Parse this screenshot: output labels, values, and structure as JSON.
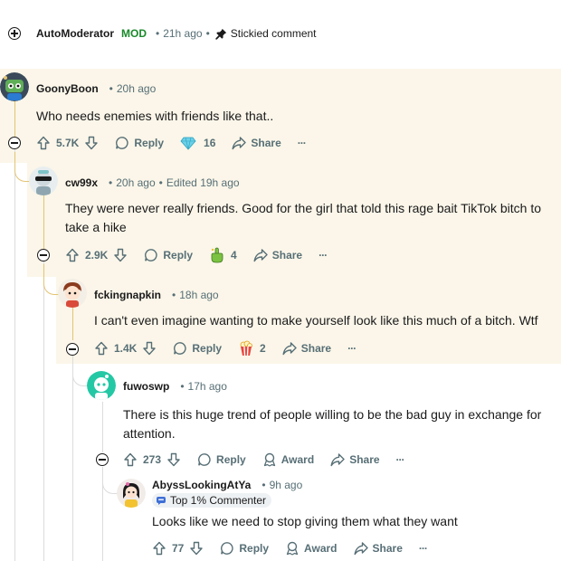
{
  "automod": {
    "user": "AutoModerator",
    "flair": "MOD",
    "time": "21h ago",
    "sticky": "Stickied comment"
  },
  "comments": [
    {
      "user": "GoonyBoon",
      "time": "20h ago",
      "edited": "",
      "badge": "",
      "text": "Who needs enemies with friends like that..",
      "votes": "5.7K",
      "reply": "Reply",
      "award_count": "16",
      "share": "Share"
    },
    {
      "user": "cw99x",
      "time": "20h ago",
      "edited": "Edited 19h ago",
      "badge": "",
      "text": "They were never really friends. Good for the girl that told this rage bait TikTok bitch to take a hike",
      "votes": "2.9K",
      "reply": "Reply",
      "award_count": "4",
      "share": "Share"
    },
    {
      "user": "fckingnapkin",
      "time": "18h ago",
      "edited": "",
      "badge": "",
      "text": "I can't even imagine wanting to make yourself look like this much of a bitch. Wtf",
      "votes": "1.4K",
      "reply": "Reply",
      "award_count": "2",
      "share": "Share"
    },
    {
      "user": "fuwoswp",
      "time": "17h ago",
      "edited": "",
      "badge": "",
      "text": "There is this huge trend of people willing to be the bad guy in exchange for attention.",
      "votes": "273",
      "reply": "Reply",
      "award_label": "Award",
      "share": "Share"
    },
    {
      "user": "AbyssLookingAtYa",
      "time": "9h ago",
      "edited": "",
      "badge": "Top 1% Commenter",
      "text": "Looks like we need to stop giving them what they want",
      "votes": "77",
      "reply": "Reply",
      "award_label": "Award",
      "share": "Share"
    }
  ],
  "more_label": "···",
  "colors": {
    "highlight": "#fbf6e9",
    "thread_gold": "#e3c472",
    "mod_green": "#1a8a2a",
    "muted": "#576f76"
  }
}
